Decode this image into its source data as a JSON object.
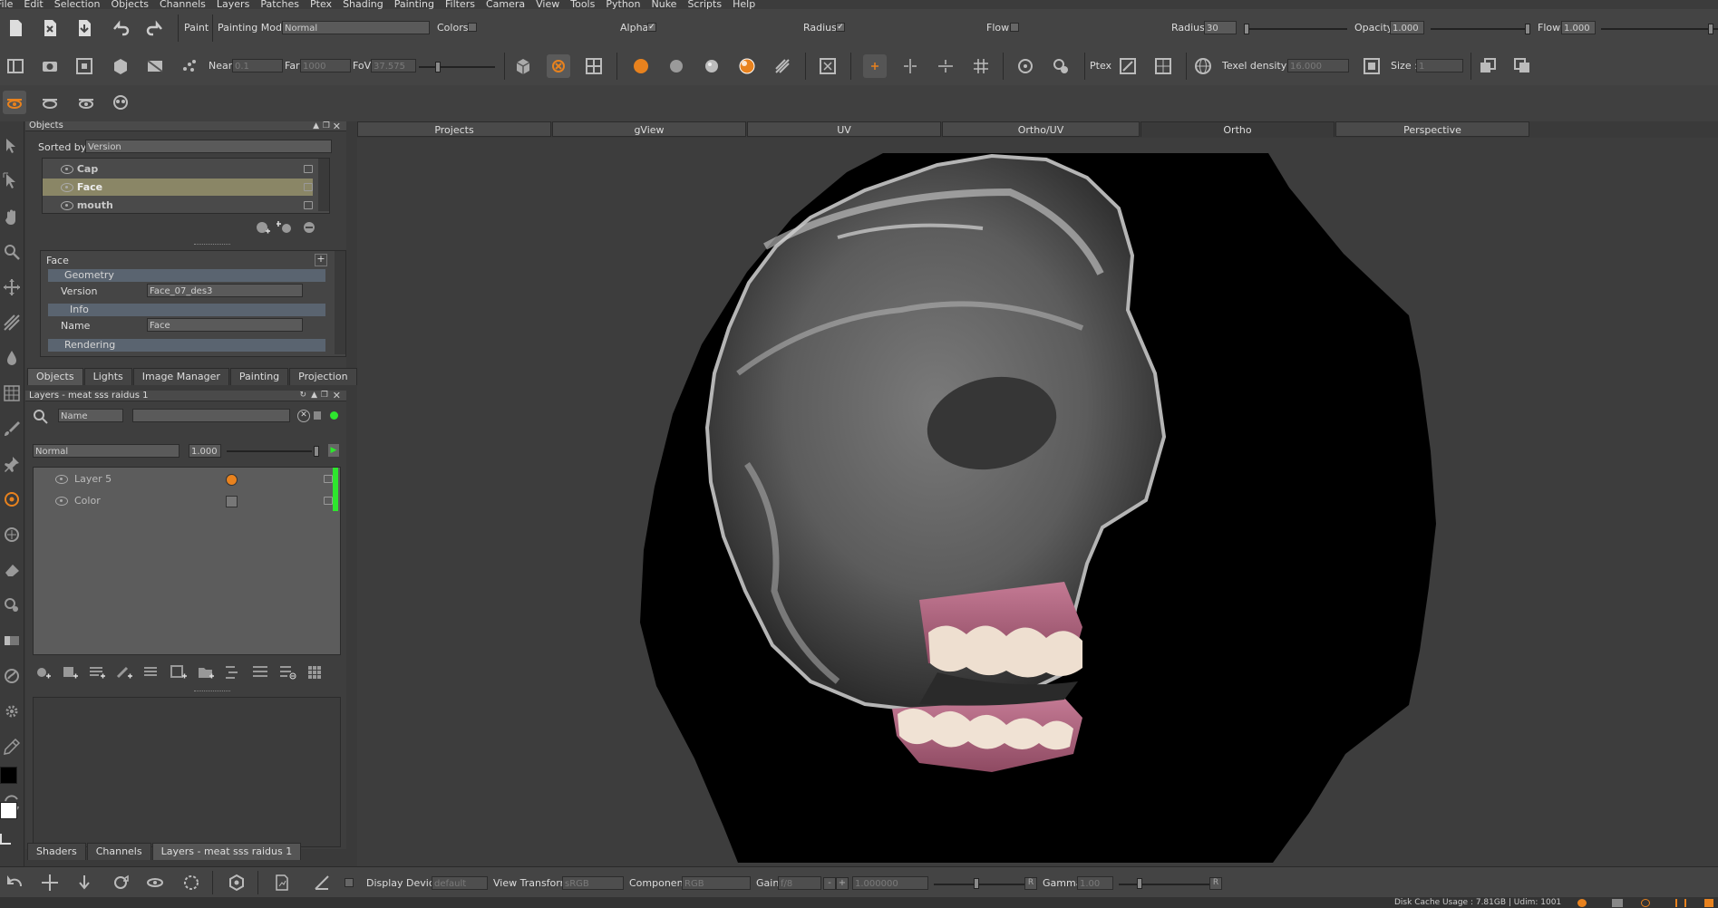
{
  "menu": [
    "File",
    "Edit",
    "Selection",
    "Objects",
    "Channels",
    "Layers",
    "Patches",
    "Ptex",
    "Shading",
    "Painting",
    "Filters",
    "Camera",
    "View",
    "Tools",
    "Python",
    "Nuke",
    "Scripts",
    "Help"
  ],
  "toolbar1": {
    "paint": "Paint",
    "painting_mode_label": "Painting Mode",
    "painting_mode_value": "Normal",
    "colors_label": "Colors",
    "alpha_label": "Alpha",
    "radius_label": "Radius",
    "flow_label": "Flow",
    "radius_value_label": "Radius",
    "radius_value": "30",
    "opacity_label": "Opacity",
    "opacity_value": "1.000",
    "flow_value_label": "Flow",
    "flow_value": "1.000"
  },
  "toolbar2": {
    "near_label": "Near",
    "near_value": "0.1",
    "far_label": "Far",
    "far_value": "1000",
    "fov_label": "FoV",
    "fov_value": "37.575",
    "ptex_label": "Ptex",
    "texel_label": "Texel density :",
    "texel_value": "16.000",
    "size_label": "Size :",
    "size_value": "1"
  },
  "objects_panel": {
    "title": "Objects",
    "sorted_by_label": "Sorted by",
    "sorted_by_value": "Version",
    "items": [
      {
        "name": "Cap"
      },
      {
        "name": "Face"
      },
      {
        "name": "mouth"
      }
    ],
    "props_title": "Face",
    "geometry_label": "Geometry",
    "version_label": "Version",
    "version_value": "Face_07_des3",
    "info_label": "Info",
    "name_label": "Name",
    "name_value": "Face",
    "rendering_label": "Rendering"
  },
  "panel_tabs": [
    "Objects",
    "Lights",
    "Image Manager",
    "Painting",
    "Projection"
  ],
  "layers_panel": {
    "title": "Layers - meat sss raidus 1",
    "filter_value": "Name",
    "blend_mode": "Normal",
    "opacity": "1.000",
    "layers": [
      {
        "name": "Layer 5"
      },
      {
        "name": "Color"
      }
    ]
  },
  "bottom_tabs": [
    "Shaders",
    "Channels",
    "Layers - meat sss raidus 1"
  ],
  "view_tabs": [
    "Projects",
    "gView",
    "UV",
    "Ortho/UV",
    "Ortho",
    "Perspective"
  ],
  "bottom_bar": {
    "display_device_label": "Display Device",
    "display_device_value": "default",
    "view_transform_label": "View Transform",
    "view_transform_value": "sRGB",
    "component_label": "Component",
    "component_value": "RGB",
    "gain_label": "Gain",
    "gain_value": "f/8",
    "gain_num": "1.000000",
    "gamma_label": "Gamma",
    "gamma_value": "1.00"
  },
  "status": {
    "disk_cache": "Disk Cache Usage : 7.81GB | Udim: 1001"
  },
  "colors": {
    "accent": "#e8821e",
    "layer_green": "#2ee62e",
    "selected_row": "#8a8666"
  }
}
